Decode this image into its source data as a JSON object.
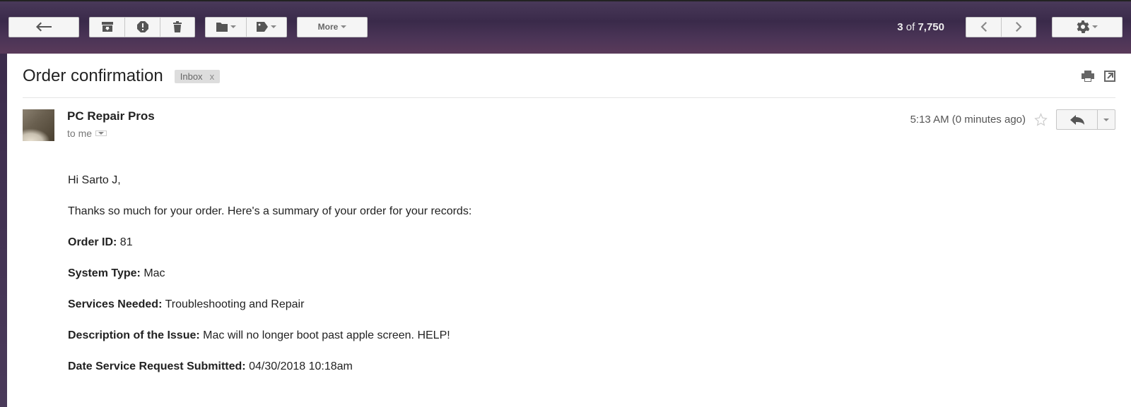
{
  "toolbar": {
    "more_label": "More"
  },
  "pagination": {
    "current": "3",
    "of_label": "of",
    "total": "7,750"
  },
  "message": {
    "subject": "Order confirmation",
    "label": "Inbox",
    "sender_name": "PC Repair Pros",
    "recipient_prefix": "to",
    "recipient": "me",
    "timestamp": "5:13 AM (0 minutes ago)"
  },
  "body": {
    "greeting": "Hi Sarto J,",
    "intro": "Thanks so much for your order. Here's a summary of your order for your records:",
    "fields": {
      "order_id": {
        "label": "Order ID:",
        "value": "81"
      },
      "system_type": {
        "label": "System Type:",
        "value": "Mac"
      },
      "services": {
        "label": "Services Needed:",
        "value": "Troubleshooting and Repair"
      },
      "description": {
        "label": "Description of the Issue:",
        "value": "Mac will no longer boot past apple screen. HELP!"
      },
      "date": {
        "label": "Date Service Request Submitted:",
        "value": "04/30/2018 10:18am"
      }
    }
  }
}
